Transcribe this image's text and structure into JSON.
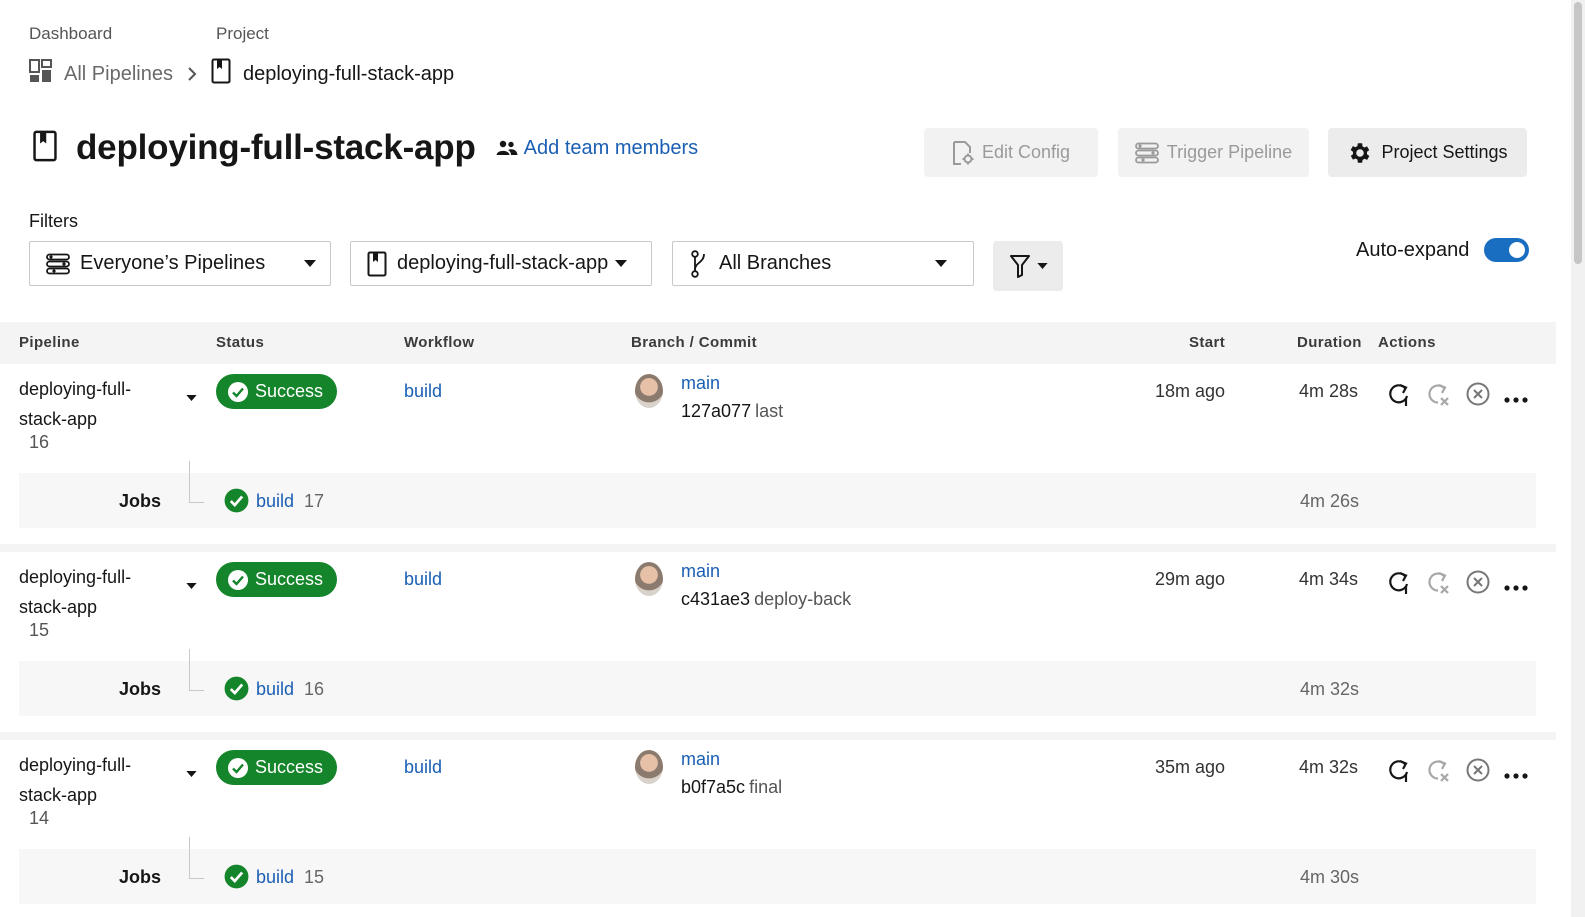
{
  "breadcrumb": {
    "dashboard_label": "Dashboard",
    "project_label": "Project",
    "all_pipelines": "All Pipelines",
    "project_name": "deploying-full-stack-app"
  },
  "header": {
    "title": "deploying-full-stack-app",
    "add_team": "Add team members",
    "edit_config": "Edit Config",
    "trigger_pipeline": "Trigger Pipeline",
    "project_settings": "Project Settings"
  },
  "filters": {
    "label": "Filters",
    "pipelines": "Everyone’s Pipelines",
    "project": "deploying-full-stack-app",
    "branches": "All Branches",
    "auto_expand": "Auto-expand",
    "auto_expand_on": true
  },
  "table": {
    "headers": {
      "pipeline": "Pipeline",
      "status": "Status",
      "workflow": "Workflow",
      "branch_commit": "Branch / Commit",
      "start": "Start",
      "duration": "Duration",
      "actions": "Actions"
    },
    "rows": [
      {
        "pipeline": "deploying-full-stack-app",
        "number": "16",
        "status": "Success",
        "workflow": "build",
        "branch": "main",
        "commit": "127a077",
        "message": "last",
        "start": "18m ago",
        "duration": "4m 28s",
        "jobs_label": "Jobs",
        "job_name": "build",
        "job_number": "17",
        "job_duration": "4m 26s"
      },
      {
        "pipeline": "deploying-full-stack-app",
        "number": "15",
        "status": "Success",
        "workflow": "build",
        "branch": "main",
        "commit": "c431ae3",
        "message": "deploy-back",
        "start": "29m ago",
        "duration": "4m 34s",
        "jobs_label": "Jobs",
        "job_name": "build",
        "job_number": "16",
        "job_duration": "4m 32s"
      },
      {
        "pipeline": "deploying-full-stack-app",
        "number": "14",
        "status": "Success",
        "workflow": "build",
        "branch": "main",
        "commit": "b0f7a5c",
        "message": "final",
        "start": "35m ago",
        "duration": "4m 32s",
        "jobs_label": "Jobs",
        "job_name": "build",
        "job_number": "15",
        "job_duration": "4m 30s"
      }
    ]
  },
  "colors": {
    "success": "#15852b",
    "link": "#1a5fb4",
    "toggle": "#1a6ec2"
  }
}
